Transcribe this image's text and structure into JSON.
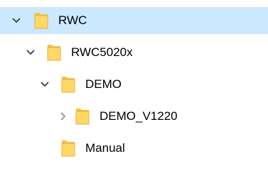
{
  "colors": {
    "selection": "#cce8ff",
    "folder_body": "#ffd866",
    "folder_back": "#f5c14a",
    "chevron": "#3c3c3c",
    "chevron_collapsed": "#8a8a8a"
  },
  "tree": {
    "items": [
      {
        "label": "RWC",
        "state": "expanded",
        "selected": true,
        "icon": "folder-icon"
      },
      {
        "label": "RWC5020x",
        "state": "expanded",
        "selected": false,
        "icon": "folder-icon"
      },
      {
        "label": "DEMO",
        "state": "expanded",
        "selected": false,
        "icon": "folder-icon"
      },
      {
        "label": "DEMO_V1220",
        "state": "collapsed",
        "selected": false,
        "icon": "folder-icon"
      },
      {
        "label": "Manual",
        "state": "leaf",
        "selected": false,
        "icon": "folder-icon"
      }
    ]
  }
}
